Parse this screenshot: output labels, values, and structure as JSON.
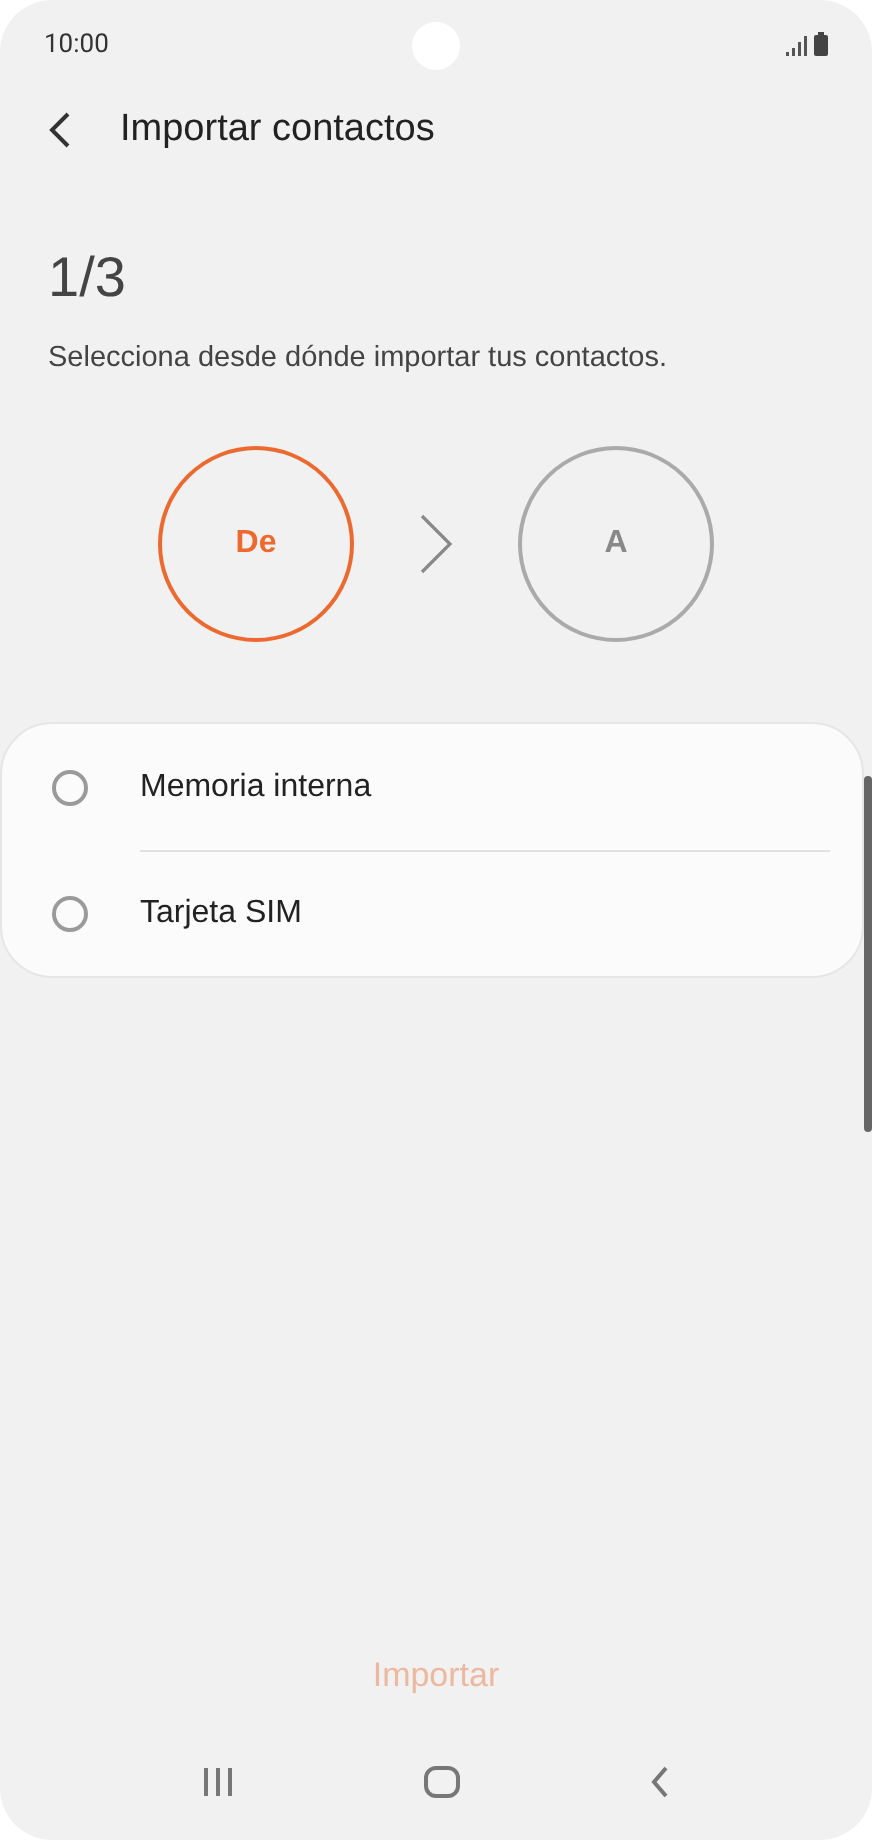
{
  "status_bar": {
    "time": "10:00"
  },
  "header": {
    "title": "Importar contactos"
  },
  "step": {
    "counter": "1/3",
    "description": "Selecciona desde dónde importar tus contactos."
  },
  "stages": [
    {
      "label": "De",
      "selected": true
    },
    {
      "label": "A",
      "selected": false
    }
  ],
  "sources": [
    {
      "label": "Memoria interna",
      "selected": false
    },
    {
      "label": "Tarjeta SIM",
      "selected": false
    }
  ],
  "action": {
    "label": "Importar",
    "disabled": true
  }
}
